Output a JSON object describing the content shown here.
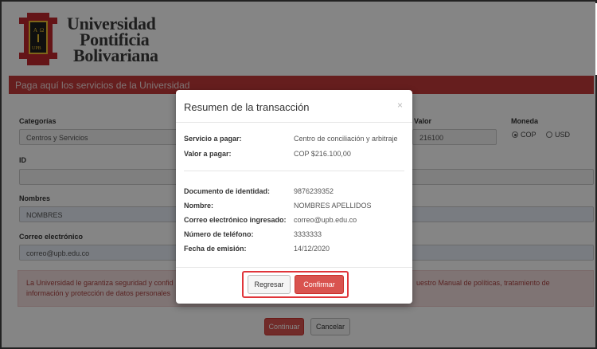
{
  "header": {
    "logo_letters": [
      "A",
      "Ω",
      "UPB"
    ],
    "brand_line1": "Universidad",
    "brand_line2": "Pontificia",
    "brand_line3": "Bolivariana"
  },
  "banner": {
    "title": "Paga aquí los servicios de la Universidad"
  },
  "form": {
    "categorias_label": "Categorías",
    "categorias_value": "Centros y Servicios",
    "valor_label": "Valor",
    "valor_value": "216100",
    "moneda_label": "Moneda",
    "moneda_options": [
      "COP",
      "USD"
    ],
    "moneda_selected": "COP",
    "id_label": "ID",
    "nombres_label": "Nombres",
    "nombres_value": "NOMBRES",
    "correo_label": "Correo electrónico",
    "correo_value": "correo@upb.edu.co"
  },
  "alert": {
    "text_left": "La Universidad le garantiza seguridad y confid",
    "text_left_line2": "información y protección de datos personales",
    "text_right_prefix": "uestro ",
    "text_right_link": "Manual de políticas, tratamiento de"
  },
  "buttons": {
    "continuar": "Continuar",
    "cancelar": "Cancelar"
  },
  "modal": {
    "title": "Resumen de la transacción",
    "close": "×",
    "servicio_label": "Servicio a pagar:",
    "servicio_value": "Centro de conciliación y arbitraje",
    "valor_label": "Valor a pagar:",
    "valor_value": "COP $216.100,00",
    "documento_label": "Documento de identidad:",
    "documento_value": "9876239352",
    "nombre_label": "Nombre:",
    "nombre_value": "NOMBRES APELLIDOS",
    "correo_label": "Correo electrónico ingresado:",
    "correo_value": "correo@upb.edu.co",
    "telefono_label": "Número de teléfono:",
    "telefono_value": "3333333",
    "fecha_label": "Fecha de emisión:",
    "fecha_value": "14/12/2020",
    "regresar": "Regresar",
    "confirmar": "Confirmar"
  },
  "colors": {
    "brand_red": "#c33b3b",
    "button_red": "#d9534f",
    "highlight": "#e0353a"
  }
}
